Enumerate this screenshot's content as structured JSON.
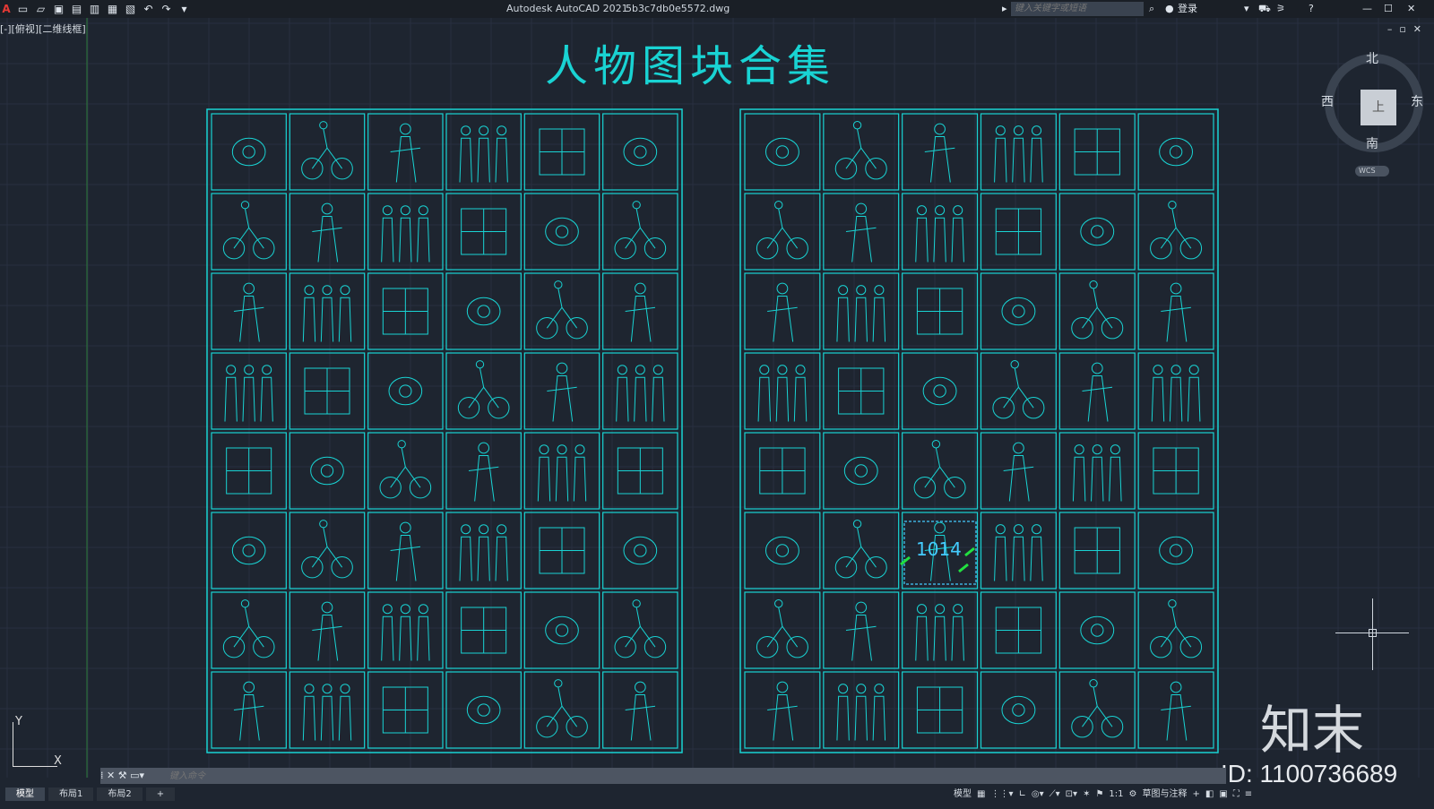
{
  "titlebar": {
    "app_title": "Autodesk AutoCAD 2021",
    "file_name": "5b3c7db0e5572.dwg",
    "search_placeholder": "键入关键字或短语",
    "login_label": "登录"
  },
  "viewport": {
    "label": "[-][俯视][二维线框]"
  },
  "drawing": {
    "title": "人物图块合集",
    "left_panel": {
      "columns": 6,
      "rows": 8
    },
    "right_panel": {
      "columns": 6,
      "rows": 8
    },
    "highlight_text": "1014"
  },
  "viewcube": {
    "north": "北",
    "south": "南",
    "east": "东",
    "west": "西",
    "face": "上",
    "wcs": "WCS"
  },
  "ucs": {
    "x": "X",
    "y": "Y"
  },
  "command": {
    "placeholder": "键入命令"
  },
  "tabs": [
    {
      "label": "模型",
      "active": true
    },
    {
      "label": "布局1",
      "active": false
    },
    {
      "label": "布局2",
      "active": false
    },
    {
      "label": "+",
      "active": false
    }
  ],
  "status": {
    "model_label": "模型",
    "scale_label": "1:1",
    "workspace_label": "草图与注释"
  },
  "watermark": {
    "logo": "知末",
    "id": "ID: 1100736689"
  },
  "colors": {
    "background": "#1e2530",
    "cyan": "#19d3d3",
    "grid": "#283040",
    "highlight": "#22e040"
  }
}
